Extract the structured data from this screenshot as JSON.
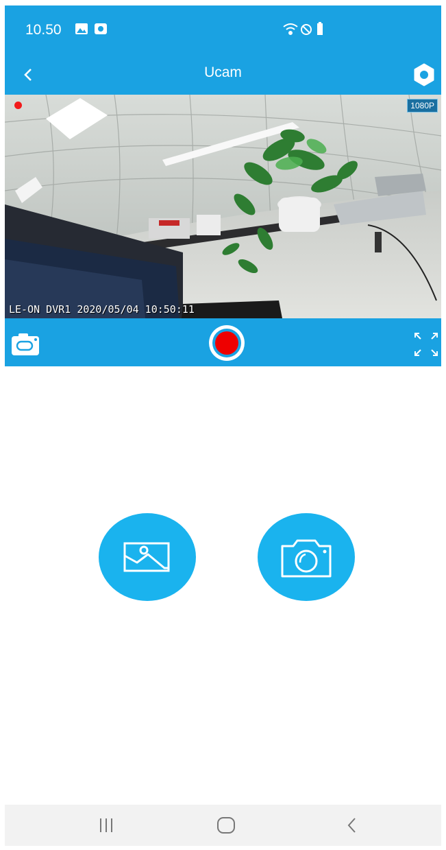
{
  "status_bar": {
    "time": "10.50",
    "icons": [
      "gallery-notification-icon",
      "media-notification-icon",
      "wifi-icon",
      "do-not-disturb-icon",
      "battery-icon"
    ]
  },
  "app_bar": {
    "title": "Ucam",
    "back_icon": "chevron-left-icon",
    "settings_icon": "gear-icon"
  },
  "video": {
    "resolution": "1080P",
    "osd_text": "LE-ON DVR1 2020/05/04 10:50:11",
    "recording_indicator_color": "#f21b1b"
  },
  "controls": {
    "snapshot_icon": "camera-icon",
    "record_icon": "record-icon",
    "fullscreen_icon": "fullscreen-icon"
  },
  "actions": {
    "gallery_icon": "image-icon",
    "camera_icon": "camera-icon"
  },
  "nav_bar": {
    "items": [
      "recent-apps-icon",
      "home-icon",
      "back-icon"
    ]
  },
  "colors": {
    "primary": "#1aa2e2",
    "action": "#1ab3ee",
    "record": "#ee0000"
  }
}
